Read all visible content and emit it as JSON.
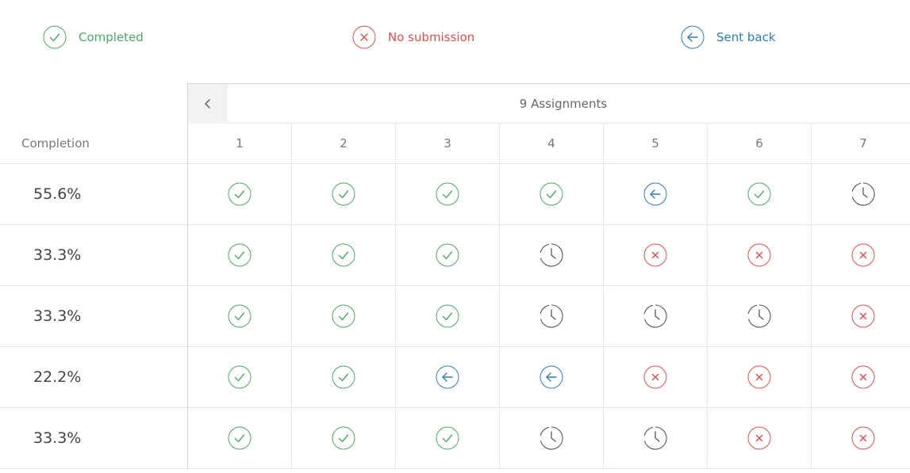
{
  "legend": [
    {
      "label": "Completed",
      "status": "completed",
      "color": "#4ea867"
    },
    {
      "label": "No submission",
      "status": "missing",
      "color": "#d9534f"
    },
    {
      "label": "Sent back",
      "status": "sent_back",
      "color": "#2f7fb0"
    }
  ],
  "header": {
    "back_icon": "chevron-left-icon",
    "title": "9 Assignments"
  },
  "table": {
    "completion_label": "Completion",
    "columns": [
      "1",
      "2",
      "3",
      "4",
      "5",
      "6",
      "7"
    ],
    "rows": [
      {
        "completion": "55.6%",
        "statuses": [
          "completed",
          "completed",
          "completed",
          "completed",
          "sent_back",
          "completed",
          "pending"
        ]
      },
      {
        "completion": "33.3%",
        "statuses": [
          "completed",
          "completed",
          "completed",
          "pending",
          "missing",
          "missing",
          "missing"
        ]
      },
      {
        "completion": "33.3%",
        "statuses": [
          "completed",
          "completed",
          "completed",
          "pending",
          "pending",
          "pending",
          "missing"
        ]
      },
      {
        "completion": "22.2%",
        "statuses": [
          "completed",
          "completed",
          "sent_back",
          "sent_back",
          "missing",
          "missing",
          "missing"
        ]
      },
      {
        "completion": "33.3%",
        "statuses": [
          "completed",
          "completed",
          "completed",
          "pending",
          "pending",
          "missing",
          "missing"
        ]
      }
    ]
  },
  "colors": {
    "completed": "#4ea867",
    "missing": "#d9534f",
    "sent_back": "#2f7fb0",
    "pending": "#555555"
  },
  "icons": {
    "completed": "check-circle-icon",
    "missing": "x-circle-icon",
    "sent_back": "arrow-left-circle-icon",
    "pending": "clock-icon"
  }
}
